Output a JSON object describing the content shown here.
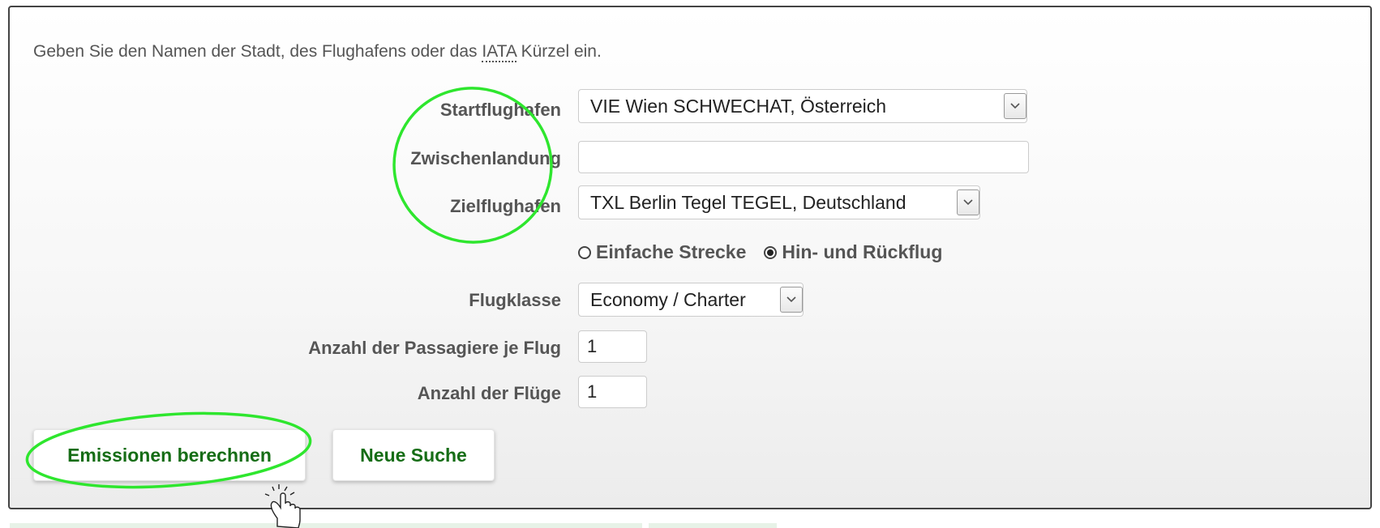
{
  "intro": {
    "prefix": "Geben Sie den Namen der Stadt, des Flughafens oder das ",
    "abbr": "IATA",
    "suffix": " Kürzel ein."
  },
  "form": {
    "start_label": "Startflughafen",
    "start_value": "VIE Wien SCHWECHAT, Österreich",
    "stopover_label": "Zwischenlandung",
    "stopover_value": "",
    "dest_label": "Zielflughafen",
    "dest_value": "TXL Berlin Tegel TEGEL, Deutschland",
    "trip_options": [
      {
        "label": "Einfache Strecke",
        "selected": false
      },
      {
        "label": "Hin- und Rückflug",
        "selected": true
      }
    ],
    "class_label": "Flugklasse",
    "class_value": "Economy / Charter",
    "passengers_label": "Anzahl der Passagiere je Flug",
    "passengers_value": "1",
    "flights_label": "Anzahl der Flüge",
    "flights_value": "1"
  },
  "buttons": {
    "calculate": "Emissionen berechnen",
    "new_search": "Neue Suche"
  },
  "colors": {
    "button_text": "#166d16",
    "highlight": "#2ee62e"
  }
}
